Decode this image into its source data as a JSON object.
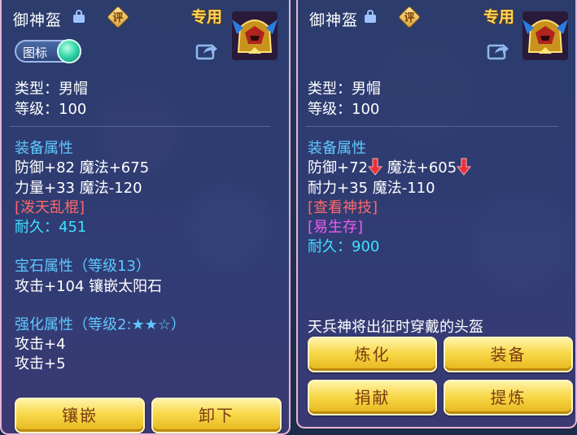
{
  "left_panel": {
    "title": "御神盔",
    "eval_label": "评",
    "exclusive_label": "专用",
    "icon_toggle_label": "图标",
    "type_line": "类型：男帽",
    "level_line": "等级：100",
    "equip_attr_header": "装备属性",
    "attr_line_1": "防御+82 魔法+675",
    "attr_line_2": "力量+33 魔法-120",
    "special_skill": "[泼天乱棍]",
    "durability": "耐久：451",
    "gem_header": "宝石属性（等级13）",
    "gem_line": "攻击+104 镶嵌太阳石",
    "enhance_header": "强化属性（等级2:★★☆）",
    "enhance_line_1": "攻击+4",
    "enhance_line_2": "攻击+5",
    "btn_inlay": "镶嵌",
    "btn_unequip": "卸下"
  },
  "right_panel": {
    "title": "御神盔",
    "eval_label": "评",
    "exclusive_label": "专用",
    "type_line": "类型：男帽",
    "level_line": "等级：100",
    "equip_attr_header": "装备属性",
    "attr_line_1a": "防御+72",
    "attr_line_1b": "魔法+605",
    "attr_line_2": "耐力+35 魔法-110",
    "special_skill": "[查看神技]",
    "special_effect": "[易生存]",
    "durability": "耐久：900",
    "description": "天兵神将出征时穿戴的头盔",
    "btn_refine": "炼化",
    "btn_equip": "装备",
    "btn_donate": "捐献",
    "btn_extract": "提炼"
  },
  "colors": {
    "attr_header": "#5fc8ff",
    "special_skill_left": "#ff6868",
    "durability": "#3fe0ff",
    "special_effect": "#ef5cf2",
    "decrease_arrow": "#e8323a",
    "button_gold": "#f8d94a",
    "exclusive_gold": "#ffd75a"
  },
  "icons": [
    "lock-icon",
    "eval-icon",
    "helmet-icon",
    "share-icon",
    "toggle-knob",
    "arrow-down-icon"
  ]
}
